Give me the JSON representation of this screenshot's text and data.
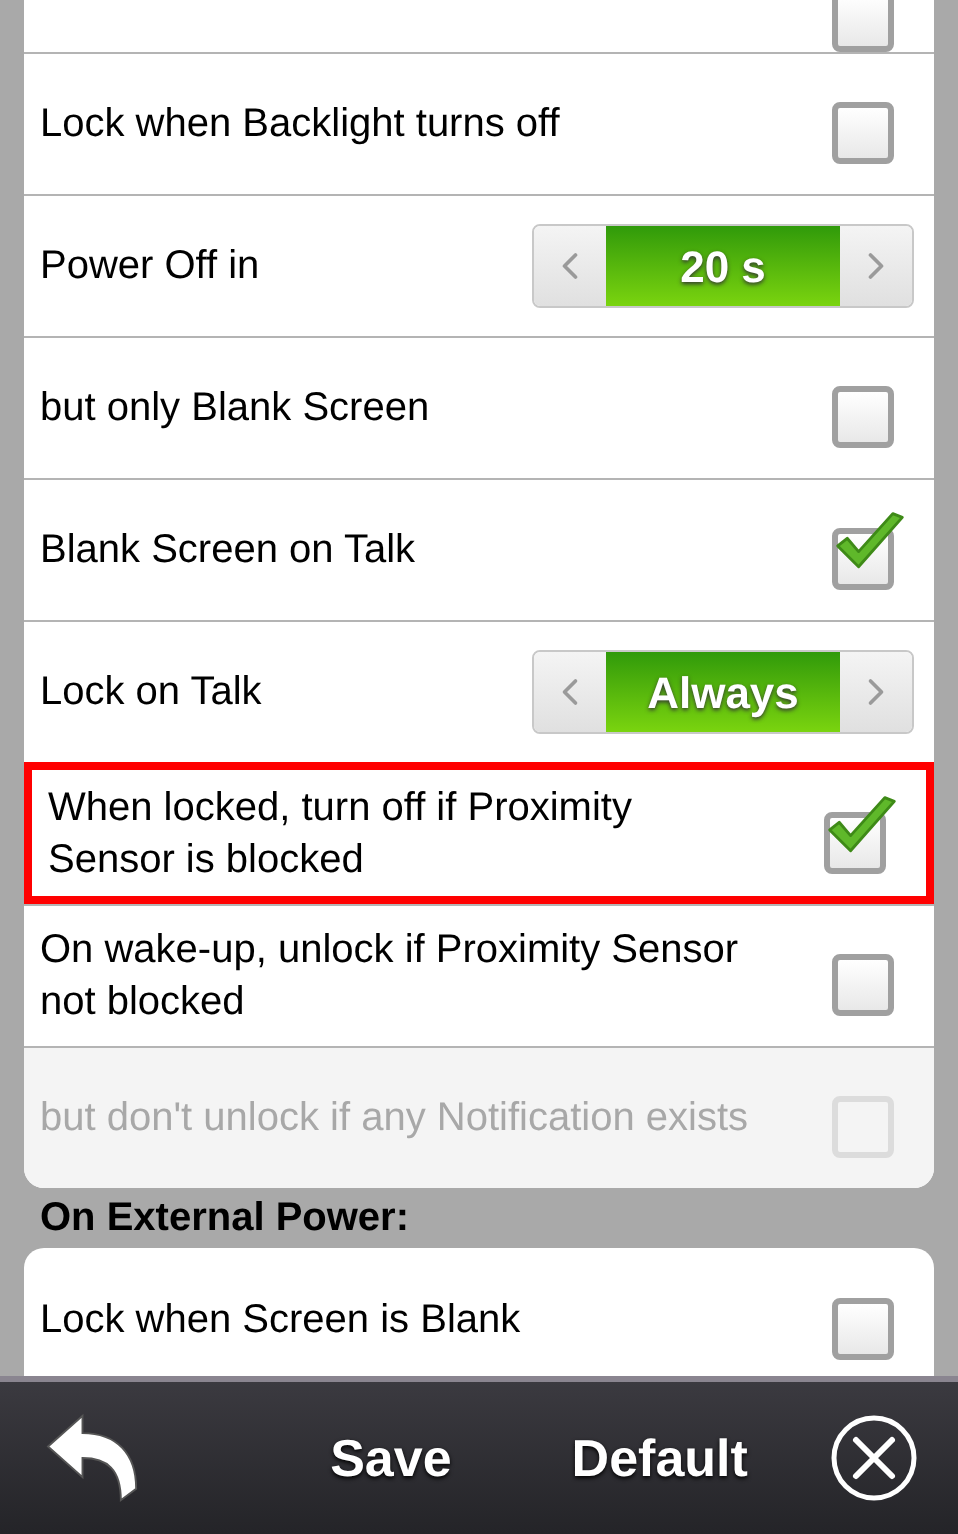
{
  "sections": [
    {
      "rows": [
        {
          "kind": "checkbox",
          "checked": false,
          "disabled": false,
          "highlighted": false
        },
        {
          "kind": "checkbox",
          "label": "Lock when Backlight turns off",
          "checked": false,
          "disabled": false,
          "highlighted": false
        },
        {
          "kind": "selector",
          "label": "Power Off in",
          "value": "20 s",
          "highlighted": false
        },
        {
          "kind": "checkbox",
          "label": "but only Blank Screen",
          "checked": false,
          "disabled": false,
          "highlighted": false
        },
        {
          "kind": "checkbox",
          "label": "Blank Screen on Talk",
          "checked": true,
          "disabled": false,
          "highlighted": false
        },
        {
          "kind": "selector",
          "label": "Lock on Talk",
          "value": "Always",
          "highlighted": false
        },
        {
          "kind": "checkbox",
          "label": "When locked, turn off if Proximity Sensor is blocked",
          "checked": true,
          "disabled": false,
          "highlighted": true
        },
        {
          "kind": "checkbox",
          "label": "On wake-up, unlock if Proximity Sensor not blocked",
          "checked": false,
          "disabled": false,
          "highlighted": false
        },
        {
          "kind": "checkbox",
          "label": "but don't unlock if any Notification exists",
          "checked": false,
          "disabled": true,
          "highlighted": false
        }
      ]
    },
    {
      "title": "On External Power:",
      "rows": [
        {
          "kind": "checkbox",
          "label": "Lock when Screen is Blank",
          "checked": false,
          "disabled": false,
          "highlighted": false
        }
      ]
    }
  ],
  "toolbar": {
    "buttons": [
      {
        "kind": "back"
      },
      {
        "kind": "text",
        "label": "Save"
      },
      {
        "kind": "text",
        "label": "Default"
      },
      {
        "kind": "close"
      }
    ]
  }
}
